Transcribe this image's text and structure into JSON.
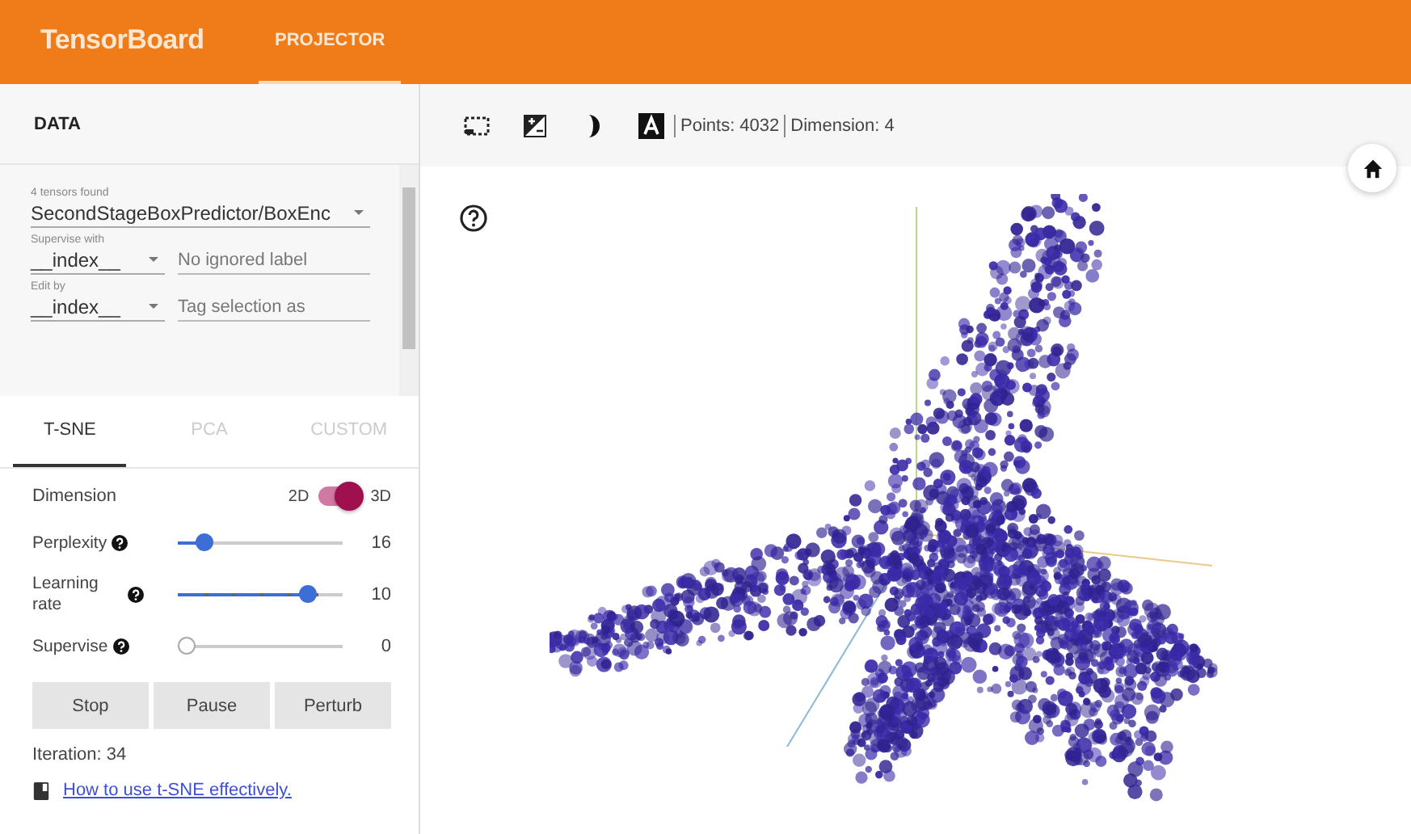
{
  "header": {
    "title": "TensorBoard",
    "tabs": [
      {
        "label": "PROJECTOR",
        "selected": true
      }
    ]
  },
  "data_panel": {
    "title": "DATA",
    "tensor": {
      "label": "4 tensors found",
      "value": "SecondStageBoxPredictor/BoxEnc"
    },
    "fields": [
      {
        "label": "Supervise with",
        "value": "__index__",
        "placeholder": "No ignored label"
      },
      {
        "label": "Edit by",
        "value": "__index__",
        "placeholder": "Tag selection as"
      }
    ]
  },
  "method_tabs": [
    {
      "label": "T-SNE",
      "selected": true
    },
    {
      "label": "PCA",
      "selected": false
    },
    {
      "label": "CUSTOM",
      "selected": false
    }
  ],
  "dimension": {
    "label": "Dimension",
    "off_label": "2D",
    "on_label": "3D",
    "on": true
  },
  "sliders": [
    {
      "label": "Perplexity",
      "level": 0.12,
      "reading": "16",
      "ticks": false
    },
    {
      "label": "Learning rate",
      "level": 0.82,
      "reading": "10",
      "ticks": true
    },
    {
      "label": "Supervise",
      "level": 0,
      "reading": "0",
      "ticks": false
    }
  ],
  "buttons": [
    "Stop",
    "Pause",
    "Perturb"
  ],
  "iteration": "Iteration: 34",
  "link": "How to use t-SNE effectively.",
  "toolbar": {
    "points": "Points: 4032",
    "dimension": "Dimension: 4"
  }
}
